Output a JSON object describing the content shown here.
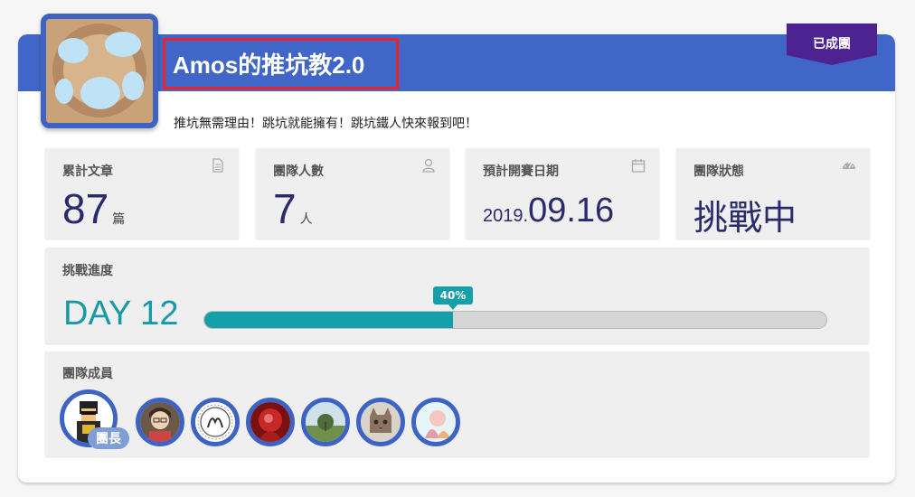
{
  "team": {
    "title": "Amos的推坑教2.0",
    "slogan": "推坑無需理由！跳坑就能擁有！跳坑鐵人快來報到吧！",
    "status_badge": "已成團"
  },
  "stats": {
    "articles": {
      "label": "累計文章",
      "value": "87",
      "unit": "篇",
      "icon": "document-icon"
    },
    "members": {
      "label": "團隊人數",
      "value": "7",
      "unit": "人",
      "icon": "user-icon"
    },
    "start_date": {
      "label": "預計開賽日期",
      "year": "2019.",
      "date": "09.16",
      "icon": "calendar-icon"
    },
    "status": {
      "label": "團隊狀態",
      "value": "挑戰中",
      "icon": "dashboard-icon"
    }
  },
  "progress": {
    "label": "挑戰進度",
    "day": "DAY 12",
    "percent_label": "40%",
    "percent": 40
  },
  "members_section": {
    "label": "團隊成員",
    "leader_badge": "團長",
    "count": 7
  },
  "colors": {
    "banner": "#4067c7",
    "ribbon": "#4c2391",
    "accent_teal": "#14a0a8",
    "value_navy": "#2a2a6d",
    "title_outline": "#e8232b"
  }
}
